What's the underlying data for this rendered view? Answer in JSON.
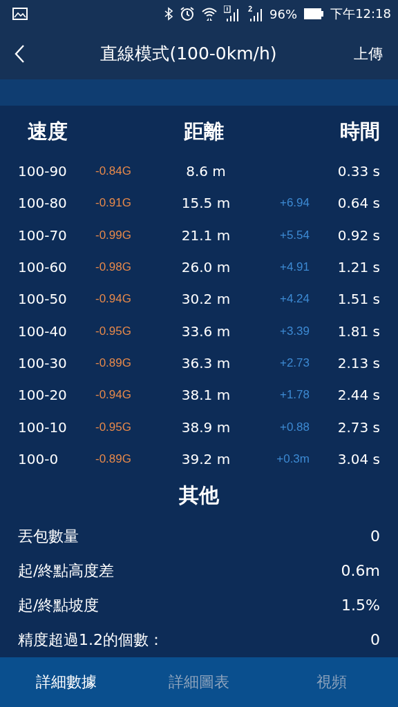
{
  "status_bar": {
    "battery": "96%",
    "time": "下午12:18"
  },
  "header": {
    "title": "直線模式(100-0km/h)",
    "action": "上傳"
  },
  "table": {
    "columns": [
      "速度",
      "距離",
      "時間"
    ],
    "rows": [
      {
        "range": "100-90",
        "g": "-0.84G",
        "distance": "8.6 m",
        "time": "0.33 s"
      },
      {
        "range": "100-80",
        "g": "-0.91G",
        "distance": "15.5 m",
        "diff": "+6.94",
        "time": "0.64 s"
      },
      {
        "range": "100-70",
        "g": "-0.99G",
        "distance": "21.1 m",
        "diff": "+5.54",
        "time": "0.92 s"
      },
      {
        "range": "100-60",
        "g": "-0.98G",
        "distance": "26.0 m",
        "diff": "+4.91",
        "time": "1.21 s"
      },
      {
        "range": "100-50",
        "g": "-0.94G",
        "distance": "30.2 m",
        "diff": "+4.24",
        "time": "1.51 s"
      },
      {
        "range": "100-40",
        "g": "-0.95G",
        "distance": "33.6 m",
        "diff": "+3.39",
        "time": "1.81 s"
      },
      {
        "range": "100-30",
        "g": "-0.89G",
        "distance": "36.3 m",
        "diff": "+2.73",
        "time": "2.13 s"
      },
      {
        "range": "100-20",
        "g": "-0.94G",
        "distance": "38.1 m",
        "diff": "+1.78",
        "time": "2.44 s"
      },
      {
        "range": "100-10",
        "g": "-0.95G",
        "distance": "38.9 m",
        "diff": "+0.88",
        "time": "2.73 s"
      },
      {
        "range": "100-0",
        "g": "-0.89G",
        "distance": "39.2 m",
        "diff": "+0.3m",
        "time": "3.04 s"
      }
    ]
  },
  "other": {
    "title": "其他",
    "rows": [
      {
        "label": "丟包數量",
        "value": "0"
      },
      {
        "label": "起/終點高度差",
        "value": "0.6m"
      },
      {
        "label": "起/終點坡度",
        "value": "1.5%"
      },
      {
        "label": "精度超過1.2的個數：",
        "value": "0"
      }
    ]
  },
  "tabs": [
    {
      "label": "詳細數據",
      "selected": true
    },
    {
      "label": "詳細圖表",
      "selected": false
    },
    {
      "label": "視頻",
      "selected": false
    }
  ]
}
